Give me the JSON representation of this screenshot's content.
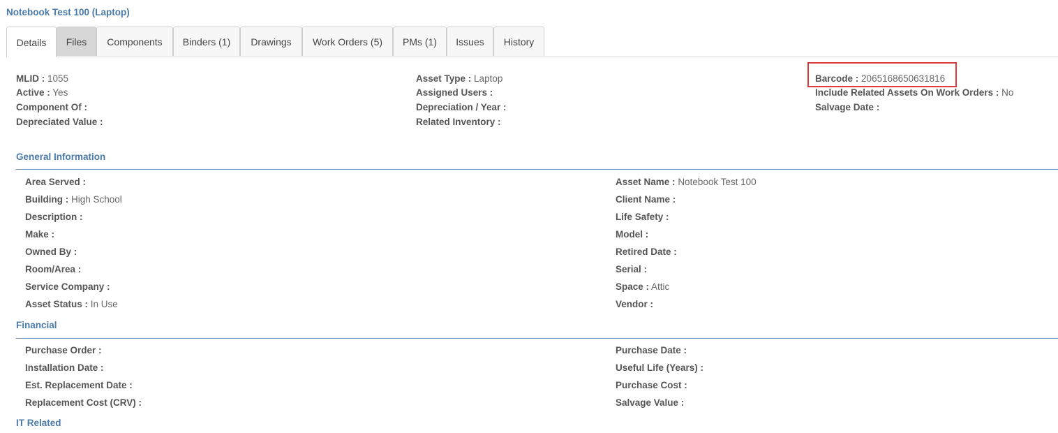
{
  "title": "Notebook Test 100 (Laptop)",
  "tabs": [
    {
      "label": "Details",
      "active": true
    },
    {
      "label": "Files"
    },
    {
      "label": "Components"
    },
    {
      "label": "Binders (1)"
    },
    {
      "label": "Drawings"
    },
    {
      "label": "Work Orders (5)"
    },
    {
      "label": "PMs (1)"
    },
    {
      "label": "Issues"
    },
    {
      "label": "History"
    }
  ],
  "summary": {
    "col1": [
      {
        "label": "MLID :",
        "value": "1055"
      },
      {
        "label": "Active :",
        "value": "Yes"
      },
      {
        "label": "Component Of :",
        "value": ""
      },
      {
        "label": "Depreciated Value :",
        "value": ""
      }
    ],
    "col2": [
      {
        "label": "Asset Type :",
        "value": "Laptop"
      },
      {
        "label": "Assigned Users :",
        "value": ""
      },
      {
        "label": "Depreciation / Year :",
        "value": ""
      },
      {
        "label": "Related Inventory :",
        "value": ""
      }
    ],
    "col3": [
      {
        "label": "Barcode :",
        "value": "2065168650631816"
      },
      {
        "label": "Include Related Assets On Work Orders :",
        "value": "No"
      },
      {
        "label": "Salvage Date :",
        "value": ""
      }
    ]
  },
  "general": {
    "heading": "General Information",
    "left": [
      {
        "label": "Area Served :",
        "value": ""
      },
      {
        "label": "Building :",
        "value": "High School"
      },
      {
        "label": "Description :",
        "value": ""
      },
      {
        "label": "Make :",
        "value": ""
      },
      {
        "label": "Owned By :",
        "value": ""
      },
      {
        "label": "Room/Area :",
        "value": ""
      },
      {
        "label": "Service Company :",
        "value": ""
      },
      {
        "label": "Asset Status :",
        "value": "In Use"
      }
    ],
    "right": [
      {
        "label": "Asset Name :",
        "value": "Notebook Test 100"
      },
      {
        "label": "Client Name :",
        "value": ""
      },
      {
        "label": "Life Safety :",
        "value": ""
      },
      {
        "label": "Model :",
        "value": ""
      },
      {
        "label": "Retired Date :",
        "value": ""
      },
      {
        "label": "Serial :",
        "value": ""
      },
      {
        "label": "Space :",
        "value": "Attic"
      },
      {
        "label": "Vendor :",
        "value": ""
      }
    ]
  },
  "financial": {
    "heading": "Financial",
    "left": [
      {
        "label": "Purchase Order :",
        "value": ""
      },
      {
        "label": "Installation Date :",
        "value": ""
      },
      {
        "label": "Est. Replacement Date :",
        "value": ""
      },
      {
        "label": "Replacement Cost (CRV) :",
        "value": ""
      }
    ],
    "right": [
      {
        "label": "Purchase Date :",
        "value": ""
      },
      {
        "label": "Useful Life (Years) :",
        "value": ""
      },
      {
        "label": "Purchase Cost :",
        "value": ""
      },
      {
        "label": "Salvage Value :",
        "value": ""
      }
    ]
  },
  "it_related": {
    "heading": "IT Related"
  }
}
